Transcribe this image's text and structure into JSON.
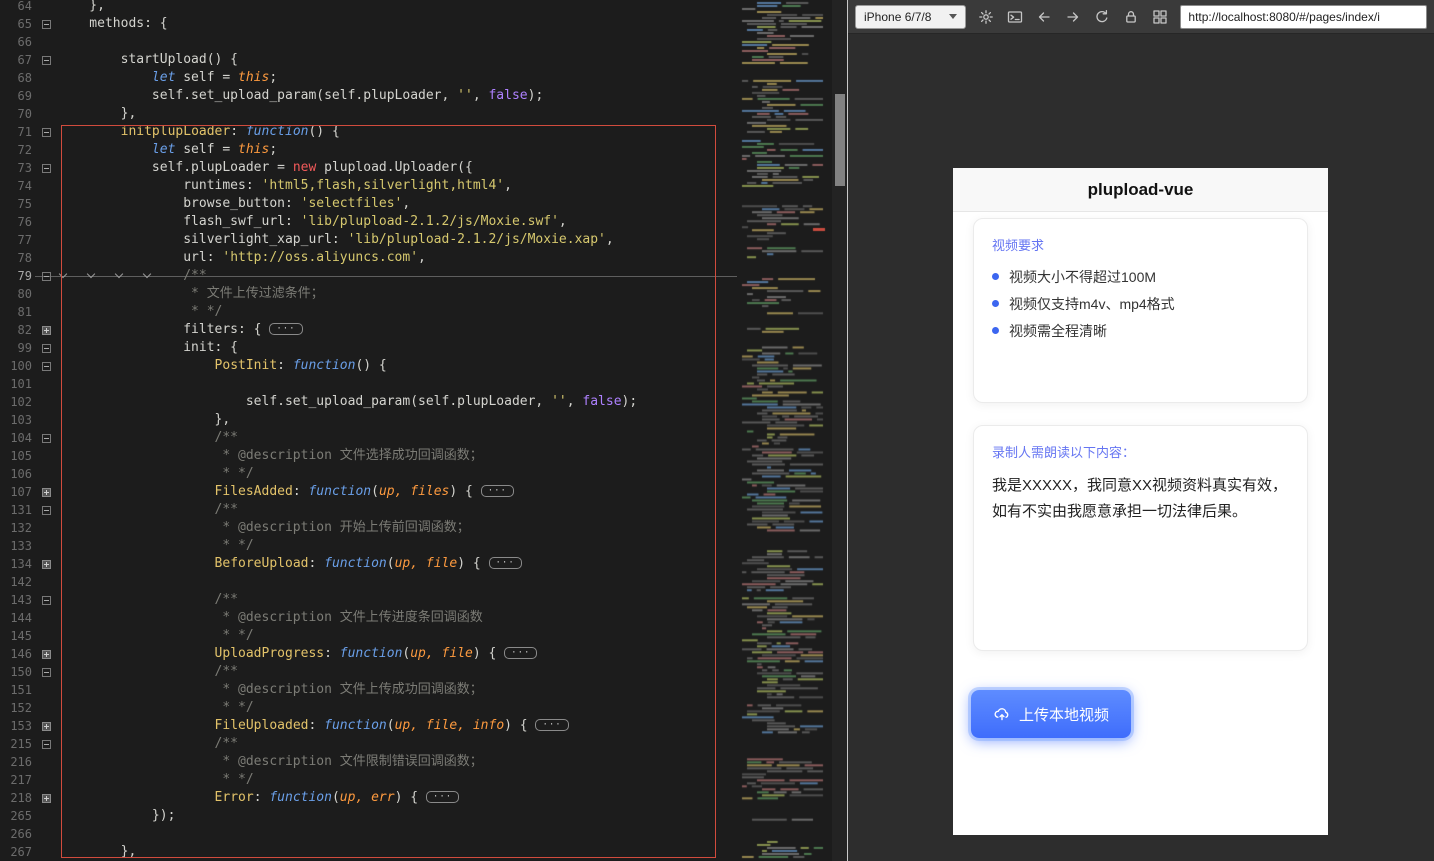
{
  "editor": {
    "current_line": 79,
    "fold_pill_label": "···",
    "lines": [
      {
        "n": 64,
        "f": "",
        "t": [
          [
            "p",
            "    },"
          ]
        ]
      },
      {
        "n": 65,
        "f": "o",
        "t": [
          [
            "p",
            "    methods: {"
          ]
        ]
      },
      {
        "n": 66,
        "f": "",
        "t": []
      },
      {
        "n": 67,
        "f": "o",
        "t": [
          [
            "p",
            "        startUpload() {"
          ]
        ]
      },
      {
        "n": 68,
        "f": "",
        "t": [
          [
            "p",
            "            "
          ],
          [
            "kw",
            "let"
          ],
          [
            "p",
            " self = "
          ],
          [
            "ths",
            "this"
          ],
          [
            "p",
            ";"
          ]
        ]
      },
      {
        "n": 69,
        "f": "",
        "t": [
          [
            "p",
            "            self.set_upload_param(self.plupLoader, "
          ],
          [
            "str",
            "''"
          ],
          [
            "p",
            ", "
          ],
          [
            "cst",
            "false"
          ],
          [
            "p",
            ");"
          ]
        ]
      },
      {
        "n": 70,
        "f": "",
        "t": [
          [
            "p",
            "        },"
          ]
        ]
      },
      {
        "n": 71,
        "f": "o",
        "t": [
          [
            "p",
            "        "
          ],
          [
            "fn",
            "initplupLoader"
          ],
          [
            "p",
            ": "
          ],
          [
            "kw",
            "function"
          ],
          [
            "p",
            "() {"
          ]
        ]
      },
      {
        "n": 72,
        "f": "",
        "t": [
          [
            "p",
            "            "
          ],
          [
            "kw",
            "let"
          ],
          [
            "p",
            " self = "
          ],
          [
            "ths",
            "this"
          ],
          [
            "p",
            ";"
          ]
        ]
      },
      {
        "n": 73,
        "f": "o",
        "t": [
          [
            "p",
            "            self.plupLoader = "
          ],
          [
            "new",
            "new"
          ],
          [
            "p",
            " plupload.Uploader({"
          ]
        ]
      },
      {
        "n": 74,
        "f": "",
        "t": [
          [
            "p",
            "                runtimes: "
          ],
          [
            "str",
            "'html5,flash,silverlight,html4'"
          ],
          [
            "p",
            ","
          ]
        ]
      },
      {
        "n": 75,
        "f": "",
        "t": [
          [
            "p",
            "                browse_button: "
          ],
          [
            "str",
            "'selectfiles'"
          ],
          [
            "p",
            ","
          ]
        ]
      },
      {
        "n": 76,
        "f": "",
        "t": [
          [
            "p",
            "                flash_swf_url: "
          ],
          [
            "str",
            "'lib/plupload-2.1.2/js/Moxie.swf'"
          ],
          [
            "p",
            ","
          ]
        ]
      },
      {
        "n": 77,
        "f": "",
        "t": [
          [
            "p",
            "                silverlight_xap_url: "
          ],
          [
            "str",
            "'lib/plupload-2.1.2/js/Moxie.xap'"
          ],
          [
            "p",
            ","
          ]
        ]
      },
      {
        "n": 78,
        "f": "",
        "t": [
          [
            "p",
            "                url: "
          ],
          [
            "str",
            "'http://oss.aliyuncs.com'"
          ],
          [
            "p",
            ","
          ]
        ]
      },
      {
        "n": 79,
        "f": "o",
        "t": [
          [
            "cmt",
            "                /**"
          ]
        ]
      },
      {
        "n": 80,
        "f": "",
        "t": [
          [
            "cmt",
            "                 * 文件上传过滤条件；"
          ]
        ]
      },
      {
        "n": 81,
        "f": "",
        "t": [
          [
            "cmt",
            "                 * */"
          ]
        ]
      },
      {
        "n": 82,
        "f": "c",
        "pill": true,
        "t": [
          [
            "p",
            "                filters: { "
          ]
        ]
      },
      {
        "n": 99,
        "f": "o",
        "t": [
          [
            "p",
            "                init: {"
          ]
        ]
      },
      {
        "n": 100,
        "f": "o",
        "t": [
          [
            "p",
            "                    "
          ],
          [
            "fn",
            "PostInit"
          ],
          [
            "p",
            ": "
          ],
          [
            "kw",
            "function"
          ],
          [
            "p",
            "() {"
          ]
        ]
      },
      {
        "n": 101,
        "f": "",
        "t": []
      },
      {
        "n": 102,
        "f": "",
        "t": [
          [
            "p",
            "                        self.set_upload_param(self.plupLoader, "
          ],
          [
            "str",
            "''"
          ],
          [
            "p",
            ", "
          ],
          [
            "cst",
            "false"
          ],
          [
            "p",
            ");"
          ]
        ]
      },
      {
        "n": 103,
        "f": "",
        "t": [
          [
            "p",
            "                    },"
          ]
        ]
      },
      {
        "n": 104,
        "f": "o",
        "t": [
          [
            "cmt",
            "                    /**"
          ]
        ]
      },
      {
        "n": 105,
        "f": "",
        "t": [
          [
            "cmt",
            "                     * @description 文件选择成功回调函数；"
          ]
        ]
      },
      {
        "n": 106,
        "f": "",
        "t": [
          [
            "cmt",
            "                     * */"
          ]
        ]
      },
      {
        "n": 107,
        "f": "c",
        "pill": true,
        "t": [
          [
            "p",
            "                    "
          ],
          [
            "fn",
            "FilesAdded"
          ],
          [
            "p",
            ": "
          ],
          [
            "kw",
            "function"
          ],
          [
            "p",
            "("
          ],
          [
            "arg",
            "up, files"
          ],
          [
            "p",
            ") { "
          ]
        ]
      },
      {
        "n": 131,
        "f": "o",
        "t": [
          [
            "cmt",
            "                    /**"
          ]
        ]
      },
      {
        "n": 132,
        "f": "",
        "t": [
          [
            "cmt",
            "                     * @description 开始上传前回调函数；"
          ]
        ]
      },
      {
        "n": 133,
        "f": "",
        "t": [
          [
            "cmt",
            "                     * */"
          ]
        ]
      },
      {
        "n": 134,
        "f": "c",
        "pill": true,
        "t": [
          [
            "p",
            "                    "
          ],
          [
            "fn",
            "BeforeUpload"
          ],
          [
            "p",
            ": "
          ],
          [
            "kw",
            "function"
          ],
          [
            "p",
            "("
          ],
          [
            "arg",
            "up, file"
          ],
          [
            "p",
            ") { "
          ]
        ]
      },
      {
        "n": 142,
        "f": "",
        "t": []
      },
      {
        "n": 143,
        "f": "o",
        "t": [
          [
            "cmt",
            "                    /**"
          ]
        ]
      },
      {
        "n": 144,
        "f": "",
        "t": [
          [
            "cmt",
            "                     * @description 文件上传进度条回调函数"
          ]
        ]
      },
      {
        "n": 145,
        "f": "",
        "t": [
          [
            "cmt",
            "                     * */"
          ]
        ]
      },
      {
        "n": 146,
        "f": "c",
        "pill": true,
        "t": [
          [
            "p",
            "                    "
          ],
          [
            "fn",
            "UploadProgress"
          ],
          [
            "p",
            ": "
          ],
          [
            "kw",
            "function"
          ],
          [
            "p",
            "("
          ],
          [
            "arg",
            "up, file"
          ],
          [
            "p",
            ") { "
          ]
        ]
      },
      {
        "n": 150,
        "f": "o",
        "t": [
          [
            "cmt",
            "                    /**"
          ]
        ]
      },
      {
        "n": 151,
        "f": "",
        "t": [
          [
            "cmt",
            "                     * @description 文件上传成功回调函数；"
          ]
        ]
      },
      {
        "n": 152,
        "f": "",
        "t": [
          [
            "cmt",
            "                     * */"
          ]
        ]
      },
      {
        "n": 153,
        "f": "c",
        "pill": true,
        "t": [
          [
            "p",
            "                    "
          ],
          [
            "fn",
            "FileUploaded"
          ],
          [
            "p",
            ": "
          ],
          [
            "kw",
            "function"
          ],
          [
            "p",
            "("
          ],
          [
            "arg",
            "up, file, info"
          ],
          [
            "p",
            ") { "
          ]
        ]
      },
      {
        "n": 215,
        "f": "o",
        "t": [
          [
            "cmt",
            "                    /**"
          ]
        ]
      },
      {
        "n": 216,
        "f": "",
        "t": [
          [
            "cmt",
            "                     * @description 文件限制错误回调函数；"
          ]
        ]
      },
      {
        "n": 217,
        "f": "",
        "t": [
          [
            "cmt",
            "                     * */"
          ]
        ]
      },
      {
        "n": 218,
        "f": "c",
        "pill": true,
        "t": [
          [
            "p",
            "                    "
          ],
          [
            "fn",
            "Error"
          ],
          [
            "p",
            ": "
          ],
          [
            "kw",
            "function"
          ],
          [
            "p",
            "("
          ],
          [
            "arg",
            "up, err"
          ],
          [
            "p",
            ") { "
          ]
        ]
      },
      {
        "n": 265,
        "f": "",
        "t": [
          [
            "p",
            "            });"
          ]
        ]
      },
      {
        "n": 266,
        "f": "",
        "t": []
      },
      {
        "n": 267,
        "f": "",
        "t": [
          [
            "p",
            "        },"
          ]
        ]
      }
    ]
  },
  "browser": {
    "device_label": "iPhone 6/7/8",
    "url": "http://localhost:8080/#/pages/index/i",
    "page": {
      "title": "plupload-vue",
      "requirements": {
        "heading": "视频要求",
        "items": [
          "视频大小不得超过100M",
          "视频仅支持m4v、mp4格式",
          "视频需全程清晰"
        ]
      },
      "statement": {
        "heading": "录制人需朗读以下内容：",
        "body": "我是XXXXX，我同意XX视频资料真实有效，如有不实由我愿意承担一切法律后果。"
      },
      "upload_button_label": "上传本地视频"
    },
    "colors": {
      "accent": "#4070fb",
      "heading_blue": "#6575f2"
    }
  }
}
